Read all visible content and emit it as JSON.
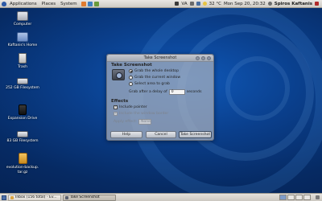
{
  "top_panel": {
    "menus": [
      "Applications",
      "Places",
      "System"
    ],
    "tray": {
      "network": "VA",
      "weather": "32 °C",
      "clock": "Mon Sep 20, 20:32",
      "user": "Spiros Kaftanis"
    }
  },
  "desktop_icons": [
    {
      "label": "Computer",
      "icon": "computer-icon",
      "color": "#d0d4dc"
    },
    {
      "label": "Kaftanis's Home",
      "icon": "home-folder-icon",
      "color": "#8aa7d6"
    },
    {
      "label": "Trash",
      "icon": "trash-icon",
      "color": "#d8d8d8"
    },
    {
      "label": "252 GB Filesystem",
      "icon": "hard-drive-icon",
      "color": "#c9ccd3"
    },
    {
      "label": "Expansion Drive",
      "icon": "external-drive-icon",
      "color": "#2a2a2a"
    },
    {
      "label": "83 GB Filesystem",
      "icon": "hard-drive-icon",
      "color": "#c9ccd3"
    },
    {
      "label": "evolution-backup.\ntar.gz",
      "icon": "archive-icon",
      "color": "#e2a82f"
    }
  ],
  "dialog": {
    "window_title": "Take Screenshot",
    "heading": "Take Screenshot",
    "grab_options": [
      {
        "label": "Grab the whole desktop",
        "selected": true
      },
      {
        "label": "Grab the current window",
        "selected": false
      },
      {
        "label": "Select area to grab",
        "selected": false
      }
    ],
    "delay_label": "Grab after a delay of",
    "delay_value": "0",
    "delay_unit": "seconds",
    "effects_heading": "Effects",
    "include_pointer": {
      "label": "Include pointer",
      "checked": true
    },
    "include_border": {
      "label": "Include the window border",
      "checked": true,
      "enabled": false
    },
    "apply_effect_label": "Apply effect:",
    "apply_effect_value": "None",
    "buttons": {
      "help": "Help",
      "cancel": "Cancel",
      "take": "Take Screenshot"
    }
  },
  "taskbar": {
    "tasks": [
      {
        "label": "Inbox (156 total) - Ev...",
        "active": false,
        "icon_color": "#d9a441"
      },
      {
        "label": "Take Screenshot",
        "active": true,
        "icon_color": "#5a6070"
      }
    ]
  },
  "colors": {
    "desktop_bg": "#0a3f8c",
    "panel": "#d8d5cf"
  }
}
